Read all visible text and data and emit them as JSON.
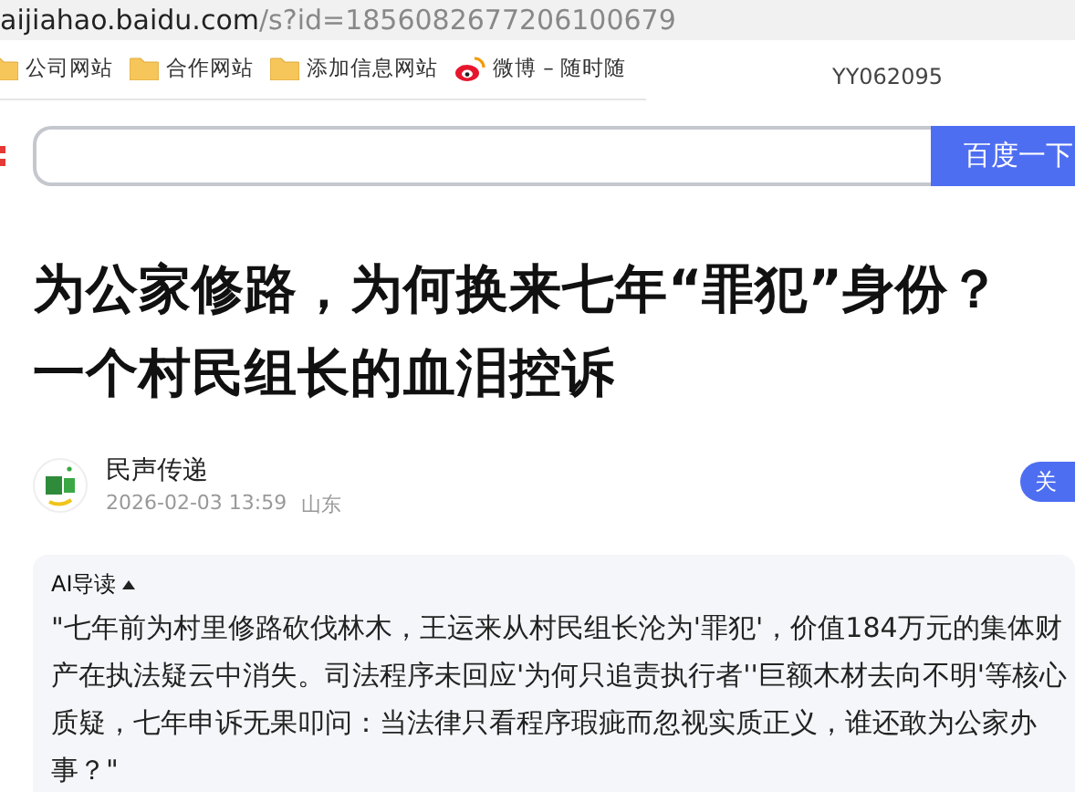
{
  "address_bar": {
    "host": "aijiahao.baidu.com",
    "path": "/s?id=1856082677206100679"
  },
  "bookmarks": [
    {
      "kind": "folder",
      "label": "公司网站"
    },
    {
      "kind": "folder",
      "label": "合作网站"
    },
    {
      "kind": "folder",
      "label": "添加信息网站"
    },
    {
      "kind": "weibo",
      "label": "微博 – 随时随"
    }
  ],
  "bookmark_note": "YY062095",
  "search": {
    "button": "百度一下"
  },
  "article": {
    "title": "为公家修路，为何换来七年“罪犯”身份？一个村民组长的血泪控诉",
    "author": "民声传递",
    "date": "2026-02-03 13:59",
    "location": "山东",
    "follow": "关"
  },
  "ai_summary": {
    "label": "AI导读",
    "expanded": true,
    "text": "\"七年前为村里修路砍伐林木，王运来从村民组长沦为'罪犯'，价值184万元的集体财产在执法疑云中消失。司法程序未回应'为何只追责执行者''巨额木材去向不明'等核心质疑，七年申诉无果叩问：当法律只看程序瑕疵而忽视实质正义，谁还敢为公家办事？\""
  }
}
